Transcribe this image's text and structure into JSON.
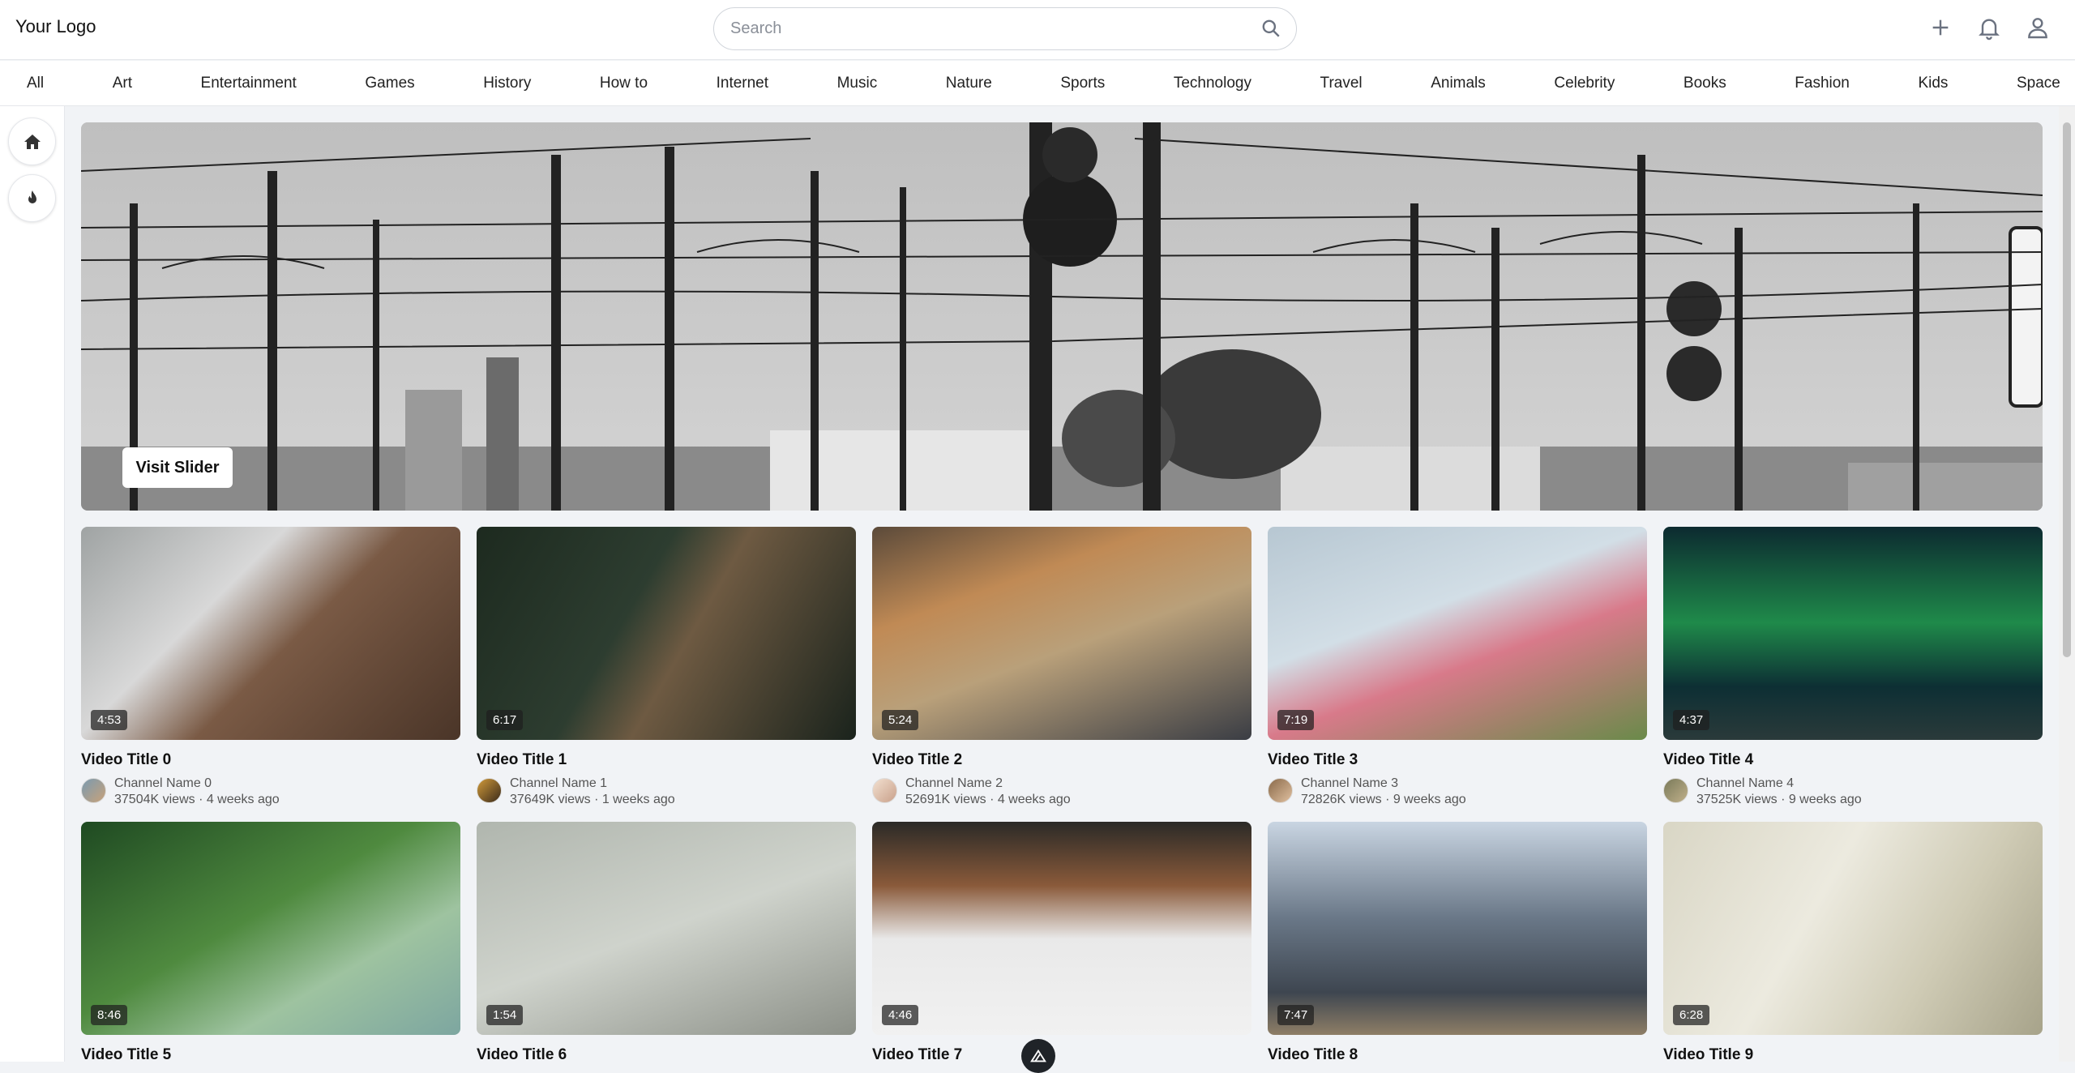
{
  "header": {
    "logo": "Your Logo",
    "search_placeholder": "Search"
  },
  "categories": [
    "All",
    "Art",
    "Entertainment",
    "Games",
    "History",
    "How to",
    "Internet",
    "Music",
    "Nature",
    "Sports",
    "Technology",
    "Travel",
    "Animals",
    "Celebrity",
    "Books",
    "Fashion",
    "Kids",
    "Space"
  ],
  "hero": {
    "button_label": "Visit Slider"
  },
  "videos": [
    {
      "title": "Video Title 0",
      "channel": "Channel Name 0",
      "stats": "37504K views · 4 weeks ago",
      "duration": "4:53"
    },
    {
      "title": "Video Title 1",
      "channel": "Channel Name 1",
      "stats": "37649K views · 1 weeks ago",
      "duration": "6:17"
    },
    {
      "title": "Video Title 2",
      "channel": "Channel Name 2",
      "stats": "52691K views · 4 weeks ago",
      "duration": "5:24"
    },
    {
      "title": "Video Title 3",
      "channel": "Channel Name 3",
      "stats": "72826K views · 9 weeks ago",
      "duration": "7:19"
    },
    {
      "title": "Video Title 4",
      "channel": "Channel Name 4",
      "stats": "37525K views · 9 weeks ago",
      "duration": "4:37"
    },
    {
      "title": "Video Title 5",
      "channel": "",
      "stats": "",
      "duration": "8:46"
    },
    {
      "title": "Video Title 6",
      "channel": "",
      "stats": "",
      "duration": "1:54"
    },
    {
      "title": "Video Title 7",
      "channel": "",
      "stats": "",
      "duration": "4:46"
    },
    {
      "title": "Video Title 8",
      "channel": "",
      "stats": "",
      "duration": "7:47"
    },
    {
      "title": "Video Title 9",
      "channel": "",
      "stats": "",
      "duration": "6:28"
    }
  ],
  "icons": {
    "search": "search-icon",
    "add": "plus-icon",
    "notifications": "bell-icon",
    "account": "user-icon",
    "home": "home-icon",
    "trending": "flame-icon"
  }
}
